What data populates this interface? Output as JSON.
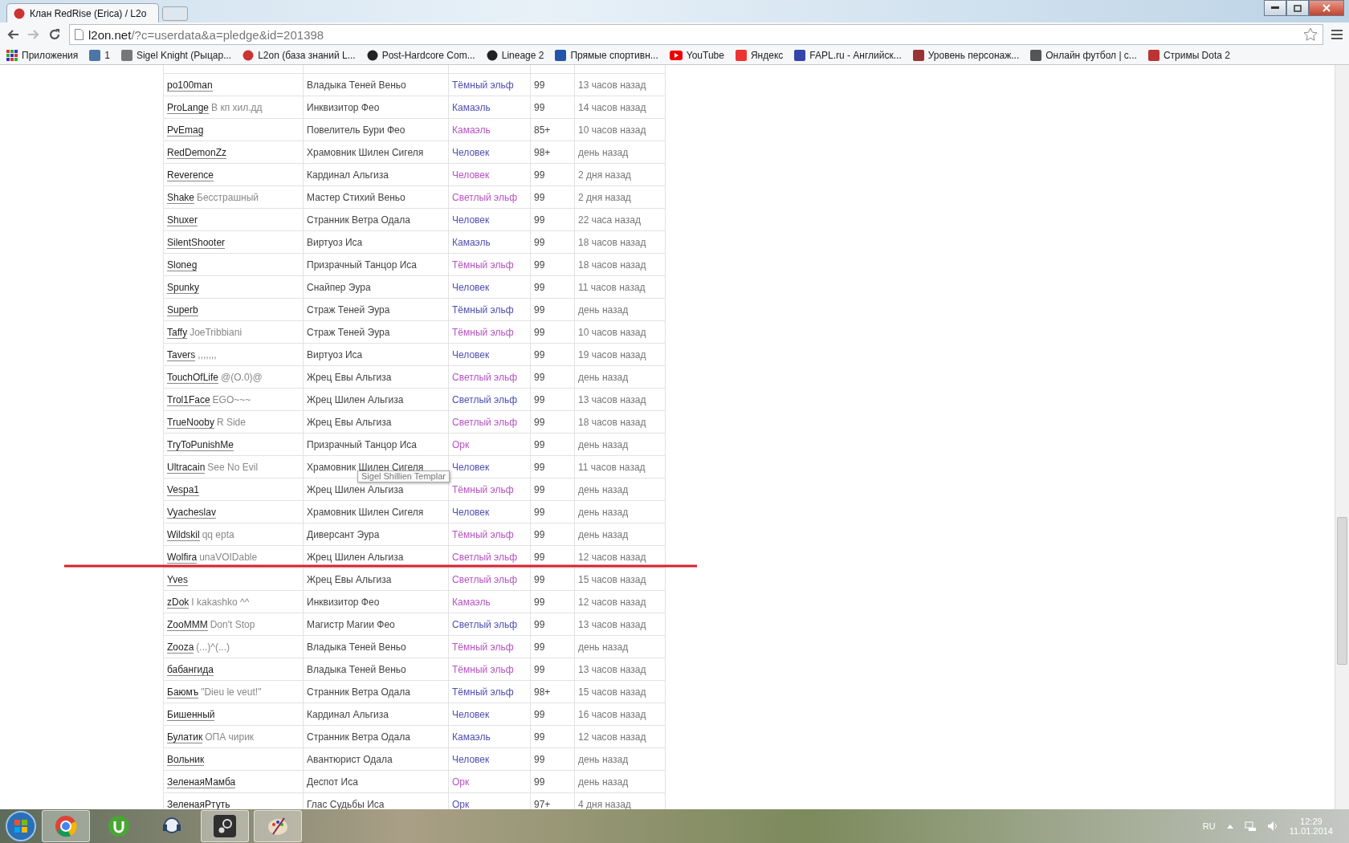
{
  "tab": {
    "title": "Клан RedRise (Erica) / L2o"
  },
  "address": {
    "host": "l2on.net",
    "path": "/?c=userdata&a=pledge&id=201398"
  },
  "bookmarks": [
    {
      "label": "Приложения",
      "kind": "apps"
    },
    {
      "label": "1",
      "kind": "vk"
    },
    {
      "label": "Sigel Knight (Рыцар...",
      "kind": "page"
    },
    {
      "label": "L2on (база знаний L...",
      "kind": "l2on"
    },
    {
      "label": "Post-Hardcore Com...",
      "kind": "panda"
    },
    {
      "label": "Lineage 2",
      "kind": "club"
    },
    {
      "label": "Прямые спортивн...",
      "kind": "letter"
    },
    {
      "label": "YouTube",
      "kind": "youtube"
    },
    {
      "label": "Яндекс",
      "kind": "yandex"
    },
    {
      "label": "FAPL.ru - Английск...",
      "kind": "fapl"
    },
    {
      "label": "Уровень персонаж...",
      "kind": "bars"
    },
    {
      "label": "Онлайн футбол | с...",
      "kind": "live"
    },
    {
      "label": "Стримы Dota 2",
      "kind": "dota"
    }
  ],
  "rows": [
    {
      "name": "po100man",
      "class": "Владыка Теней Веньо",
      "race": "Тёмный эльф",
      "color": "#4f4fb4",
      "level": "99",
      "seen": "13 часов назад"
    },
    {
      "name": "ProLange",
      "title": "В кп хил.дд",
      "class": "Инквизитор Фео",
      "race": "Камаэль",
      "color": "#4f4fb4",
      "level": "99",
      "seen": "14 часов назад"
    },
    {
      "name": "PvEmag",
      "class": "Повелитель Бури Фео",
      "race": "Камаэль",
      "color": "#b852c4",
      "level": "85+",
      "seen": "10 часов назад"
    },
    {
      "name": "RedDemonZz",
      "class": "Храмовник Шилен Сигеля",
      "race": "Человек",
      "color": "#4f4fb4",
      "level": "98+",
      "seen": "день назад"
    },
    {
      "name": "Reverence",
      "class": "Кардинал Альгиза",
      "race": "Человек",
      "color": "#b852c4",
      "level": "99",
      "seen": "2 дня назад"
    },
    {
      "name": "Shake",
      "title": "Бесстрашный",
      "class": "Мастер Стихий Веньо",
      "race": "Светлый эльф",
      "color": "#b852c4",
      "level": "99",
      "seen": "2 дня назад"
    },
    {
      "name": "Shuxer",
      "class": "Странник Ветра Одала",
      "race": "Человек",
      "color": "#4f4fb4",
      "level": "99",
      "seen": "22 часа назад"
    },
    {
      "name": "SilentShooter",
      "class": "Виртуоз Иса",
      "race": "Камаэль",
      "color": "#4f4fb4",
      "level": "99",
      "seen": "18 часов назад"
    },
    {
      "name": "Sloneg",
      "class": "Призрачный Танцор Иса",
      "race": "Тёмный эльф",
      "color": "#b852c4",
      "level": "99",
      "seen": "18 часов назад"
    },
    {
      "name": "Spunky",
      "class": "Снайпер Эура",
      "race": "Человек",
      "color": "#4f4fb4",
      "level": "99",
      "seen": "11 часов назад"
    },
    {
      "name": "Superb",
      "class": "Страж Теней Эура",
      "race": "Тёмный эльф",
      "color": "#4f4fb4",
      "level": "99",
      "seen": "день назад"
    },
    {
      "name": "Taffy",
      "title": "JoeTribbiani",
      "class": "Страж Теней Эура",
      "race": "Тёмный эльф",
      "color": "#b852c4",
      "level": "99",
      "seen": "10 часов назад"
    },
    {
      "name": "Tavers",
      "title": ",,,,,,,",
      "class": "Виртуоз Иса",
      "race": "Человек",
      "color": "#4f4fb4",
      "level": "99",
      "seen": "19 часов назад"
    },
    {
      "name": "TouchOfLife",
      "title": "@(O.0)@",
      "class": "Жрец Евы Альгиза",
      "race": "Светлый эльф",
      "color": "#b852c4",
      "level": "99",
      "seen": "день назад"
    },
    {
      "name": "Trol1Face",
      "title": "EGO~~~",
      "class": "Жрец Шилен Альгиза",
      "race": "Светлый эльф",
      "color": "#4f4fb4",
      "level": "99",
      "seen": "13 часов назад"
    },
    {
      "name": "TrueNooby",
      "title": "R Side",
      "class": "Жрец Евы Альгиза",
      "race": "Светлый эльф",
      "color": "#b852c4",
      "level": "99",
      "seen": "18 часов назад"
    },
    {
      "name": "TryToPunishMe",
      "class": "Призрачный Танцор Иса",
      "race": "Орк",
      "color": "#b852c4",
      "level": "99",
      "seen": "день назад"
    },
    {
      "name": "Ultracain",
      "title": "See No Evil",
      "class": "Храмовник Шилен Сигеля",
      "race": "Человек",
      "color": "#4f4fb4",
      "level": "99",
      "seen": "11 часов назад"
    },
    {
      "name": "Vespa1",
      "class": "Жрец Шилен Альгиза",
      "race": "Тёмный эльф",
      "color": "#b852c4",
      "level": "99",
      "seen": "день назад"
    },
    {
      "name": "Vyacheslav",
      "class": "Храмовник Шилен Сигеля",
      "race": "Человек",
      "color": "#4f4fb4",
      "level": "99",
      "seen": "день назад"
    },
    {
      "name": "Wildskil",
      "title": "qq epta",
      "class": "Диверсант Эура",
      "race": "Тёмный эльф",
      "color": "#b852c4",
      "level": "99",
      "seen": "день назад"
    },
    {
      "name": "Wolfira",
      "title": "unaVOIDable",
      "class": "Жрец Шилен Альгиза",
      "race": "Светлый эльф",
      "color": "#b852c4",
      "level": "99",
      "seen": "12 часов назад"
    },
    {
      "name": "Yves",
      "class": "Жрец Евы Альгиза",
      "race": "Светлый эльф",
      "color": "#b852c4",
      "level": "99",
      "seen": "15 часов назад"
    },
    {
      "name": "zDok",
      "title": "I kakashko ^^",
      "class": "Инквизитор Фео",
      "race": "Камаэль",
      "color": "#b852c4",
      "level": "99",
      "seen": "12 часов назад"
    },
    {
      "name": "ZooMMM",
      "title": "Don't Stop",
      "class": "Магистр Магии Фео",
      "race": "Светлый эльф",
      "color": "#4f4fb4",
      "level": "99",
      "seen": "13 часов назад"
    },
    {
      "name": "Zooza",
      "title": "(...)^(...)",
      "class": "Владыка Теней Веньо",
      "race": "Тёмный эльф",
      "color": "#b852c4",
      "level": "99",
      "seen": "день назад"
    },
    {
      "name": "бабангида",
      "class": "Владыка Теней Веньо",
      "race": "Тёмный эльф",
      "color": "#b852c4",
      "level": "99",
      "seen": "13 часов назад"
    },
    {
      "name": "Баюмъ",
      "title": "\"Dieu le veut!\"",
      "class": "Странник Ветра Одала",
      "race": "Тёмный эльф",
      "color": "#4f4fb4",
      "level": "98+",
      "seen": "15 часов назад"
    },
    {
      "name": "Бишенный",
      "class": "Кардинал Альгиза",
      "race": "Человек",
      "color": "#4f4fb4",
      "level": "99",
      "seen": "16 часов назад"
    },
    {
      "name": "Булатик",
      "title": "ОПА чирик",
      "class": "Странник Ветра Одала",
      "race": "Камаэль",
      "color": "#4f4fb4",
      "level": "99",
      "seen": "12 часов назад"
    },
    {
      "name": "Вольник",
      "class": "Авантюрист Одала",
      "race": "Человек",
      "color": "#4f4fb4",
      "level": "99",
      "seen": "день назад"
    },
    {
      "name": "ЗеленаяМамба",
      "class": "Деспот Иса",
      "race": "Орк",
      "color": "#b852c4",
      "level": "99",
      "seen": "день назад"
    },
    {
      "name": "ЗеленаяРтуть",
      "class": "Глас Судьбы Иса",
      "race": "Орк",
      "color": "#4f4fb4",
      "level": "97+",
      "seen": "4 дня назад"
    }
  ],
  "tooltip": "Sigel Shillien Templar",
  "tray": {
    "language": "RU",
    "time": "12:29",
    "date": "11.01.2014"
  }
}
